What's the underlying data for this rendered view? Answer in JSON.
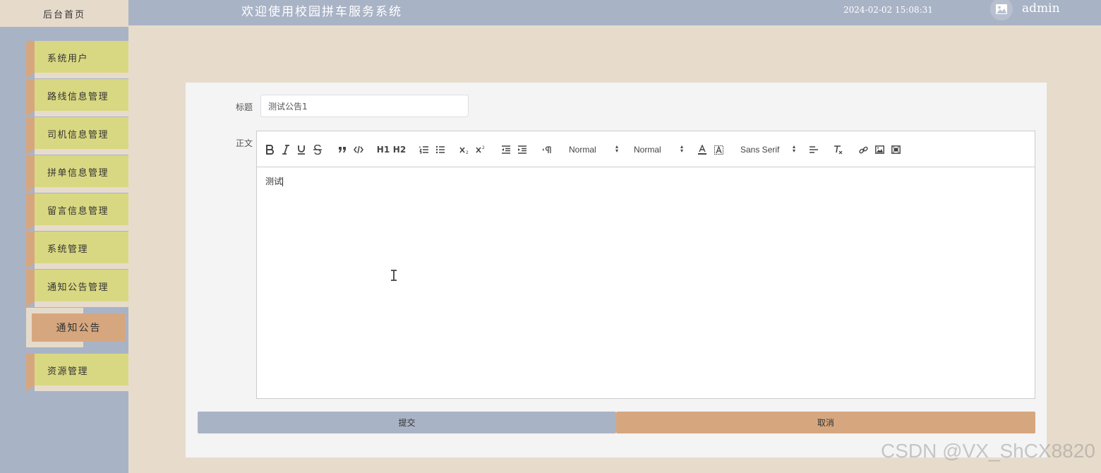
{
  "header": {
    "home_tab": "后台首页",
    "system_title": "欢迎使用校园拼车服务系统",
    "datetime": "2024-02-02 15:08:31",
    "username": "admin"
  },
  "sidebar": {
    "items": [
      {
        "label": "系统用户"
      },
      {
        "label": "路线信息管理"
      },
      {
        "label": "司机信息管理"
      },
      {
        "label": "拼单信息管理"
      },
      {
        "label": "留言信息管理"
      },
      {
        "label": "系统管理"
      },
      {
        "label": "通知公告管理"
      },
      {
        "label": "资源管理"
      }
    ],
    "active_sub_item": "通知公告"
  },
  "form": {
    "title_label": "标题",
    "title_value": "测试公告1",
    "body_label": "正文",
    "body_value": "测试",
    "submit_label": "提交",
    "cancel_label": "取消"
  },
  "toolbar": {
    "header_picker": "Normal",
    "size_picker": "Normal",
    "font_picker": "Sans Serif",
    "h1": "H1",
    "h2": "H2"
  },
  "watermark": "CSDN @VX_ShCX8820",
  "colors": {
    "topbar": "#a9b3c6",
    "background": "#e7dccc",
    "nav_item": "#d9d882",
    "accent": "#d6a77f"
  }
}
